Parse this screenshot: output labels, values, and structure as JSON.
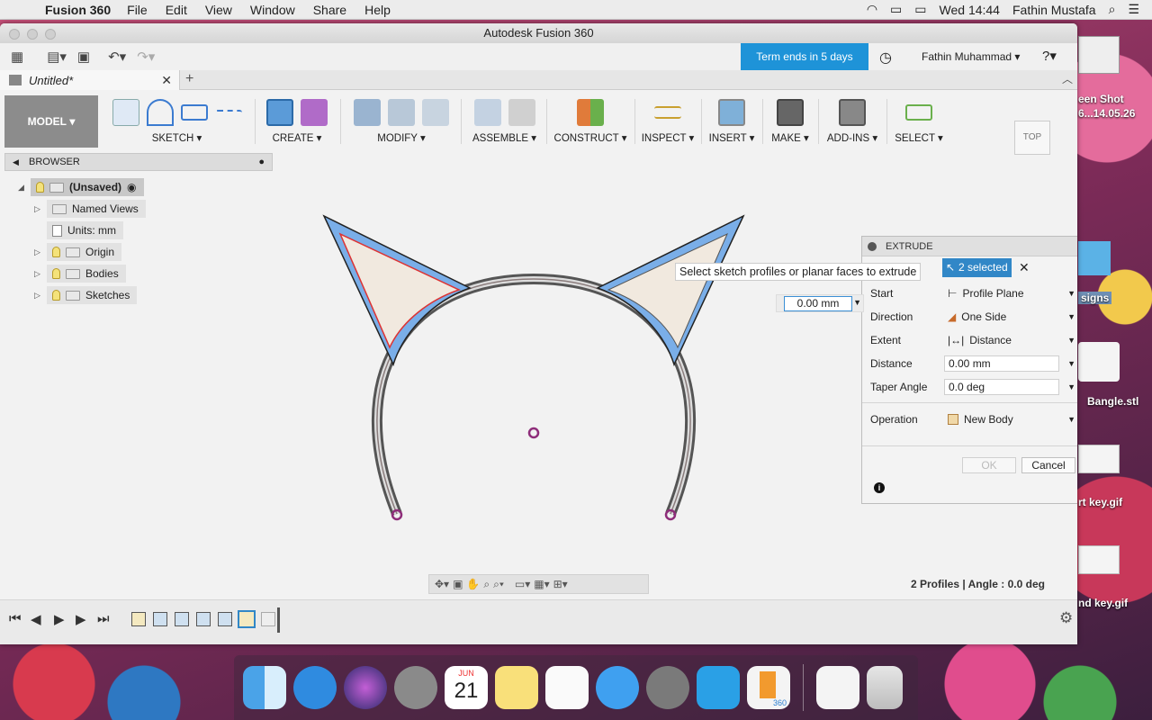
{
  "menubar": {
    "app": "Fusion 360",
    "items": [
      "File",
      "Edit",
      "View",
      "Window",
      "Share",
      "Help"
    ],
    "clock": "Wed 14:44",
    "user": "Fathin Mustafa"
  },
  "window": {
    "title": "Autodesk Fusion 360",
    "term": "Term ends in 5 days",
    "user": "Fathin Muhammad",
    "doc_tab": "Untitled*"
  },
  "toolbar": {
    "model": "MODEL",
    "groups": [
      "SKETCH",
      "CREATE",
      "MODIFY",
      "ASSEMBLE",
      "CONSTRUCT",
      "INSPECT",
      "INSERT",
      "MAKE",
      "ADD-INS",
      "SELECT"
    ]
  },
  "browser": {
    "title": "BROWSER",
    "root": "(Unsaved)",
    "items": [
      "Named Views",
      "Units: mm",
      "Origin",
      "Bodies",
      "Sketches"
    ]
  },
  "viewcube": "TOP",
  "extrude": {
    "title": "EXTRUDE",
    "tooltip": "Select sketch profiles or planar faces to extrude",
    "selected": "2 selected",
    "rows": [
      {
        "k": "Start",
        "v": "Profile Plane"
      },
      {
        "k": "Direction",
        "v": "One Side"
      },
      {
        "k": "Extent",
        "v": "Distance"
      },
      {
        "k": "Distance",
        "v": "0.00 mm"
      },
      {
        "k": "Taper Angle",
        "v": "0.0 deg"
      },
      {
        "k": "Operation",
        "v": "New Body"
      }
    ],
    "ok": "OK",
    "cancel": "Cancel",
    "canvas_value": "0.00 mm"
  },
  "status": "2 Profiles | Angle : 0.0 deg",
  "desktop": {
    "labels": [
      "een Shot",
      "6...14.05.26",
      "signs",
      "Bangle.stl",
      "rt key.gif",
      "nd key.gif"
    ],
    "calendar_month": "JUN",
    "calendar_day": "21",
    "fusion_badge": "360"
  },
  "colors": {
    "accent": "#1e93d8",
    "selection": "#3187c7",
    "sketch_blue": "#7aaee8",
    "profile_fill": "#f1e9df"
  }
}
